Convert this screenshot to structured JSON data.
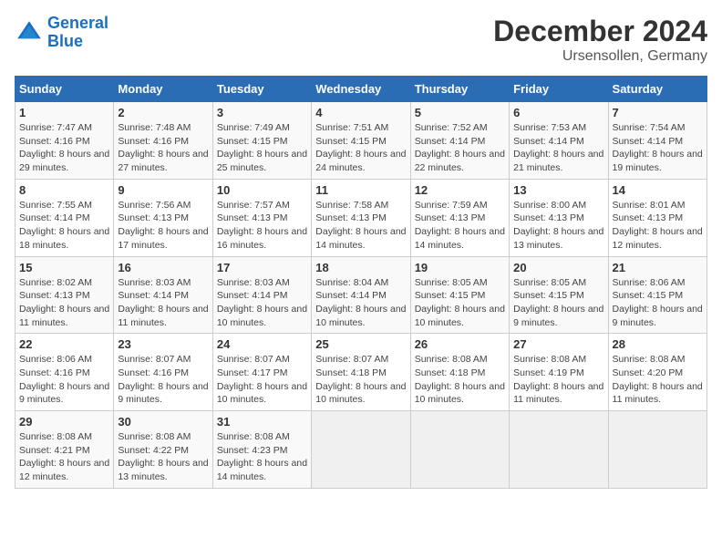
{
  "header": {
    "logo_line1": "General",
    "logo_line2": "Blue",
    "title": "December 2024",
    "subtitle": "Ursensollen, Germany"
  },
  "weekdays": [
    "Sunday",
    "Monday",
    "Tuesday",
    "Wednesday",
    "Thursday",
    "Friday",
    "Saturday"
  ],
  "weeks": [
    [
      {
        "day": "1",
        "sunrise": "Sunrise: 7:47 AM",
        "sunset": "Sunset: 4:16 PM",
        "daylight": "Daylight: 8 hours and 29 minutes."
      },
      {
        "day": "2",
        "sunrise": "Sunrise: 7:48 AM",
        "sunset": "Sunset: 4:16 PM",
        "daylight": "Daylight: 8 hours and 27 minutes."
      },
      {
        "day": "3",
        "sunrise": "Sunrise: 7:49 AM",
        "sunset": "Sunset: 4:15 PM",
        "daylight": "Daylight: 8 hours and 25 minutes."
      },
      {
        "day": "4",
        "sunrise": "Sunrise: 7:51 AM",
        "sunset": "Sunset: 4:15 PM",
        "daylight": "Daylight: 8 hours and 24 minutes."
      },
      {
        "day": "5",
        "sunrise": "Sunrise: 7:52 AM",
        "sunset": "Sunset: 4:14 PM",
        "daylight": "Daylight: 8 hours and 22 minutes."
      },
      {
        "day": "6",
        "sunrise": "Sunrise: 7:53 AM",
        "sunset": "Sunset: 4:14 PM",
        "daylight": "Daylight: 8 hours and 21 minutes."
      },
      {
        "day": "7",
        "sunrise": "Sunrise: 7:54 AM",
        "sunset": "Sunset: 4:14 PM",
        "daylight": "Daylight: 8 hours and 19 minutes."
      }
    ],
    [
      {
        "day": "8",
        "sunrise": "Sunrise: 7:55 AM",
        "sunset": "Sunset: 4:14 PM",
        "daylight": "Daylight: 8 hours and 18 minutes."
      },
      {
        "day": "9",
        "sunrise": "Sunrise: 7:56 AM",
        "sunset": "Sunset: 4:13 PM",
        "daylight": "Daylight: 8 hours and 17 minutes."
      },
      {
        "day": "10",
        "sunrise": "Sunrise: 7:57 AM",
        "sunset": "Sunset: 4:13 PM",
        "daylight": "Daylight: 8 hours and 16 minutes."
      },
      {
        "day": "11",
        "sunrise": "Sunrise: 7:58 AM",
        "sunset": "Sunset: 4:13 PM",
        "daylight": "Daylight: 8 hours and 14 minutes."
      },
      {
        "day": "12",
        "sunrise": "Sunrise: 7:59 AM",
        "sunset": "Sunset: 4:13 PM",
        "daylight": "Daylight: 8 hours and 14 minutes."
      },
      {
        "day": "13",
        "sunrise": "Sunrise: 8:00 AM",
        "sunset": "Sunset: 4:13 PM",
        "daylight": "Daylight: 8 hours and 13 minutes."
      },
      {
        "day": "14",
        "sunrise": "Sunrise: 8:01 AM",
        "sunset": "Sunset: 4:13 PM",
        "daylight": "Daylight: 8 hours and 12 minutes."
      }
    ],
    [
      {
        "day": "15",
        "sunrise": "Sunrise: 8:02 AM",
        "sunset": "Sunset: 4:13 PM",
        "daylight": "Daylight: 8 hours and 11 minutes."
      },
      {
        "day": "16",
        "sunrise": "Sunrise: 8:03 AM",
        "sunset": "Sunset: 4:14 PM",
        "daylight": "Daylight: 8 hours and 11 minutes."
      },
      {
        "day": "17",
        "sunrise": "Sunrise: 8:03 AM",
        "sunset": "Sunset: 4:14 PM",
        "daylight": "Daylight: 8 hours and 10 minutes."
      },
      {
        "day": "18",
        "sunrise": "Sunrise: 8:04 AM",
        "sunset": "Sunset: 4:14 PM",
        "daylight": "Daylight: 8 hours and 10 minutes."
      },
      {
        "day": "19",
        "sunrise": "Sunrise: 8:05 AM",
        "sunset": "Sunset: 4:15 PM",
        "daylight": "Daylight: 8 hours and 10 minutes."
      },
      {
        "day": "20",
        "sunrise": "Sunrise: 8:05 AM",
        "sunset": "Sunset: 4:15 PM",
        "daylight": "Daylight: 8 hours and 9 minutes."
      },
      {
        "day": "21",
        "sunrise": "Sunrise: 8:06 AM",
        "sunset": "Sunset: 4:15 PM",
        "daylight": "Daylight: 8 hours and 9 minutes."
      }
    ],
    [
      {
        "day": "22",
        "sunrise": "Sunrise: 8:06 AM",
        "sunset": "Sunset: 4:16 PM",
        "daylight": "Daylight: 8 hours and 9 minutes."
      },
      {
        "day": "23",
        "sunrise": "Sunrise: 8:07 AM",
        "sunset": "Sunset: 4:16 PM",
        "daylight": "Daylight: 8 hours and 9 minutes."
      },
      {
        "day": "24",
        "sunrise": "Sunrise: 8:07 AM",
        "sunset": "Sunset: 4:17 PM",
        "daylight": "Daylight: 8 hours and 10 minutes."
      },
      {
        "day": "25",
        "sunrise": "Sunrise: 8:07 AM",
        "sunset": "Sunset: 4:18 PM",
        "daylight": "Daylight: 8 hours and 10 minutes."
      },
      {
        "day": "26",
        "sunrise": "Sunrise: 8:08 AM",
        "sunset": "Sunset: 4:18 PM",
        "daylight": "Daylight: 8 hours and 10 minutes."
      },
      {
        "day": "27",
        "sunrise": "Sunrise: 8:08 AM",
        "sunset": "Sunset: 4:19 PM",
        "daylight": "Daylight: 8 hours and 11 minutes."
      },
      {
        "day": "28",
        "sunrise": "Sunrise: 8:08 AM",
        "sunset": "Sunset: 4:20 PM",
        "daylight": "Daylight: 8 hours and 11 minutes."
      }
    ],
    [
      {
        "day": "29",
        "sunrise": "Sunrise: 8:08 AM",
        "sunset": "Sunset: 4:21 PM",
        "daylight": "Daylight: 8 hours and 12 minutes."
      },
      {
        "day": "30",
        "sunrise": "Sunrise: 8:08 AM",
        "sunset": "Sunset: 4:22 PM",
        "daylight": "Daylight: 8 hours and 13 minutes."
      },
      {
        "day": "31",
        "sunrise": "Sunrise: 8:08 AM",
        "sunset": "Sunset: 4:23 PM",
        "daylight": "Daylight: 8 hours and 14 minutes."
      },
      null,
      null,
      null,
      null
    ]
  ]
}
